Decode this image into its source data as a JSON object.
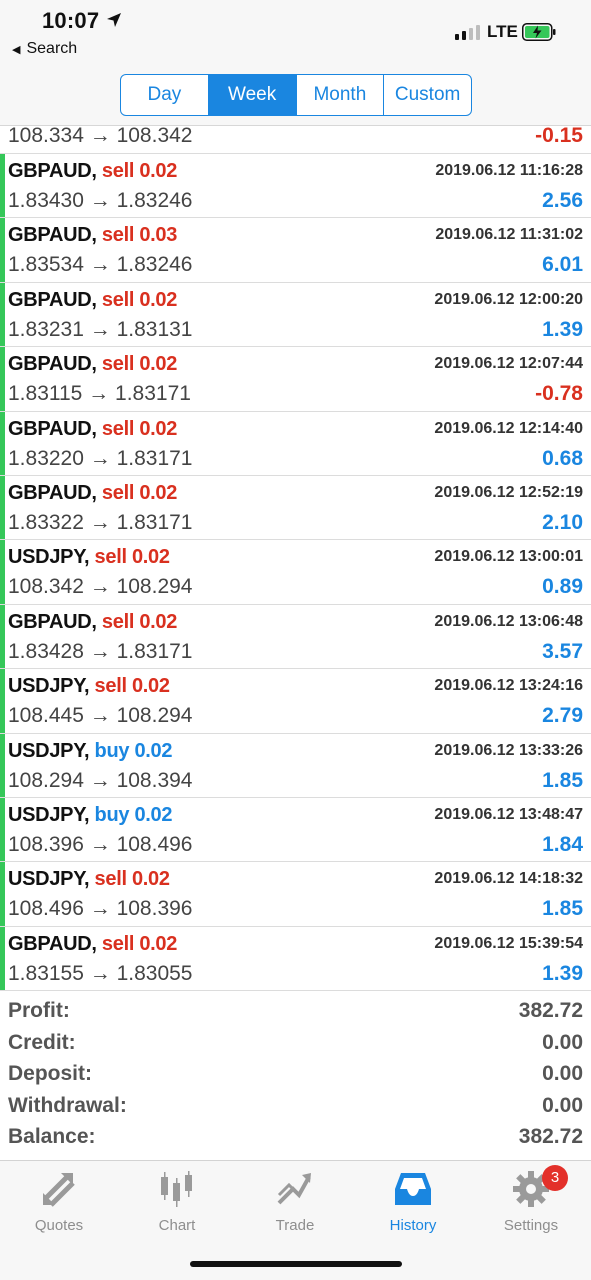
{
  "status": {
    "time": "10:07",
    "back_label": "Search",
    "network": "LTE"
  },
  "segments": [
    "Day",
    "Week",
    "Month",
    "Custom"
  ],
  "active_segment": "Week",
  "partial_row": {
    "prices": "108.334 → 108.342",
    "profit": "-0.15"
  },
  "deals": [
    {
      "symbol": "GBPAUD,",
      "action": "sell 0.02",
      "type": "sell",
      "time": "2019.06.12 11:16:28",
      "prices": "1.83430 → 1.83246",
      "profit": "2.56",
      "sign": "pos"
    },
    {
      "symbol": "GBPAUD,",
      "action": "sell 0.03",
      "type": "sell",
      "time": "2019.06.12 11:31:02",
      "prices": "1.83534 → 1.83246",
      "profit": "6.01",
      "sign": "pos"
    },
    {
      "symbol": "GBPAUD,",
      "action": "sell 0.02",
      "type": "sell",
      "time": "2019.06.12 12:00:20",
      "prices": "1.83231 → 1.83131",
      "profit": "1.39",
      "sign": "pos"
    },
    {
      "symbol": "GBPAUD,",
      "action": "sell 0.02",
      "type": "sell",
      "time": "2019.06.12 12:07:44",
      "prices": "1.83115 → 1.83171",
      "profit": "-0.78",
      "sign": "neg"
    },
    {
      "symbol": "GBPAUD,",
      "action": "sell 0.02",
      "type": "sell",
      "time": "2019.06.12 12:14:40",
      "prices": "1.83220 → 1.83171",
      "profit": "0.68",
      "sign": "pos"
    },
    {
      "symbol": "GBPAUD,",
      "action": "sell 0.02",
      "type": "sell",
      "time": "2019.06.12 12:52:19",
      "prices": "1.83322 → 1.83171",
      "profit": "2.10",
      "sign": "pos"
    },
    {
      "symbol": "USDJPY,",
      "action": "sell 0.02",
      "type": "sell",
      "time": "2019.06.12 13:00:01",
      "prices": "108.342 → 108.294",
      "profit": "0.89",
      "sign": "pos"
    },
    {
      "symbol": "GBPAUD,",
      "action": "sell 0.02",
      "type": "sell",
      "time": "2019.06.12 13:06:48",
      "prices": "1.83428 → 1.83171",
      "profit": "3.57",
      "sign": "pos"
    },
    {
      "symbol": "USDJPY,",
      "action": "sell 0.02",
      "type": "sell",
      "time": "2019.06.12 13:24:16",
      "prices": "108.445 → 108.294",
      "profit": "2.79",
      "sign": "pos"
    },
    {
      "symbol": "USDJPY,",
      "action": "buy 0.02",
      "type": "buy",
      "time": "2019.06.12 13:33:26",
      "prices": "108.294 → 108.394",
      "profit": "1.85",
      "sign": "pos"
    },
    {
      "symbol": "USDJPY,",
      "action": "buy 0.02",
      "type": "buy",
      "time": "2019.06.12 13:48:47",
      "prices": "108.396 → 108.496",
      "profit": "1.84",
      "sign": "pos"
    },
    {
      "symbol": "USDJPY,",
      "action": "sell 0.02",
      "type": "sell",
      "time": "2019.06.12 14:18:32",
      "prices": "108.496 → 108.396",
      "profit": "1.85",
      "sign": "pos"
    },
    {
      "symbol": "GBPAUD,",
      "action": "sell 0.02",
      "type": "sell",
      "time": "2019.06.12 15:39:54",
      "prices": "1.83155 → 1.83055",
      "profit": "1.39",
      "sign": "pos"
    }
  ],
  "summary": [
    {
      "label": "Profit:",
      "value": "382.72"
    },
    {
      "label": "Credit:",
      "value": "0.00"
    },
    {
      "label": "Deposit:",
      "value": "0.00"
    },
    {
      "label": "Withdrawal:",
      "value": "0.00"
    },
    {
      "label": "Balance:",
      "value": "382.72"
    }
  ],
  "tabs": [
    {
      "label": "Quotes",
      "icon": "quotes-icon"
    },
    {
      "label": "Chart",
      "icon": "chart-icon"
    },
    {
      "label": "Trade",
      "icon": "trade-icon"
    },
    {
      "label": "History",
      "icon": "history-icon"
    },
    {
      "label": "Settings",
      "icon": "gear-icon",
      "badge": "3"
    }
  ],
  "active_tab": "History",
  "colors": {
    "accent": "#1a86e0",
    "sell": "#d9301f",
    "profit_bar": "#35c759",
    "badge": "#e3302a"
  }
}
